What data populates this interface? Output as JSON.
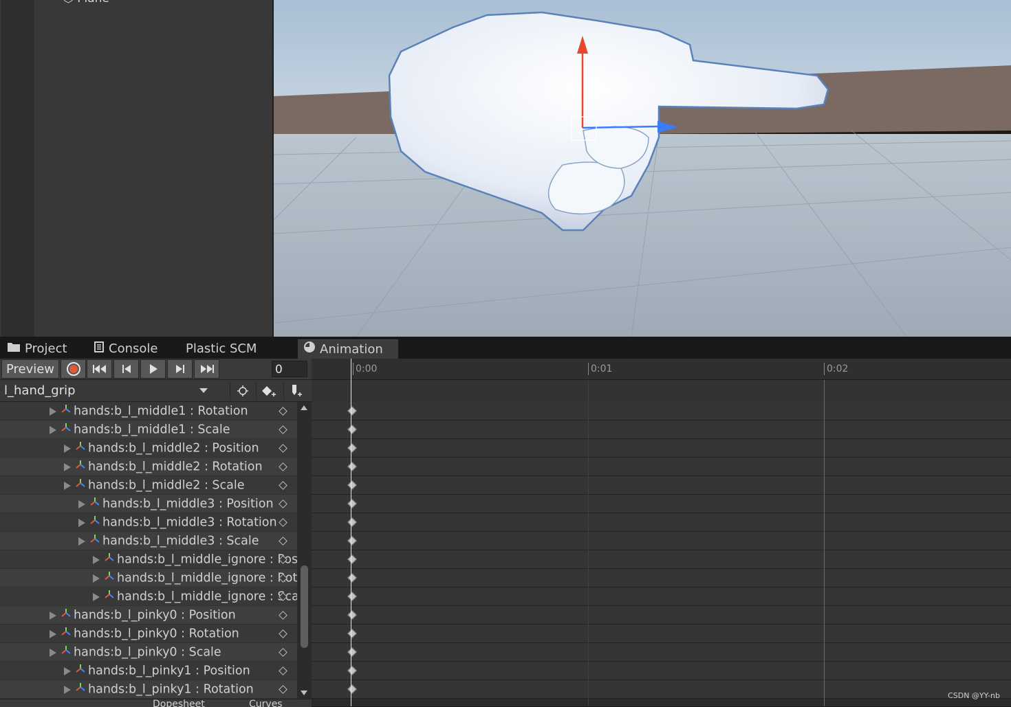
{
  "hierarchy": {
    "clipped_item": "Plane"
  },
  "tabs": [
    {
      "label": "Project",
      "icon": "folder-icon"
    },
    {
      "label": "Console",
      "icon": "console-icon"
    },
    {
      "label": "Plastic SCM",
      "icon": ""
    },
    {
      "label": "Animation",
      "icon": "clock-icon"
    }
  ],
  "toolbar": {
    "preview_label": "Preview",
    "frame_value": "0",
    "buttons": [
      "record-icon",
      "first-key-icon",
      "prev-key-icon",
      "play-icon",
      "next-key-icon",
      "last-key-icon"
    ]
  },
  "clip": {
    "name": "l_hand_grip",
    "tools": [
      "filter-by-selection-icon",
      "add-keyframe-icon",
      "add-event-icon"
    ]
  },
  "properties": [
    {
      "label": "hands:b_l_middle1 : Rotation",
      "indent": 0
    },
    {
      "label": "hands:b_l_middle1 : Scale",
      "indent": 0
    },
    {
      "label": "hands:b_l_middle2 : Position",
      "indent": 1
    },
    {
      "label": "hands:b_l_middle2 : Rotation",
      "indent": 1
    },
    {
      "label": "hands:b_l_middle2 : Scale",
      "indent": 1
    },
    {
      "label": "hands:b_l_middle3 : Position",
      "indent": 2
    },
    {
      "label": "hands:b_l_middle3 : Rotation",
      "indent": 2
    },
    {
      "label": "hands:b_l_middle3 : Scale",
      "indent": 2
    },
    {
      "label": "hands:b_l_middle_ignore : Pos",
      "indent": 3
    },
    {
      "label": "hands:b_l_middle_ignore : Rota",
      "indent": 3
    },
    {
      "label": "hands:b_l_middle_ignore : Sca",
      "indent": 3
    },
    {
      "label": "hands:b_l_pinky0 : Position",
      "indent": 0
    },
    {
      "label": "hands:b_l_pinky0 : Rotation",
      "indent": 0
    },
    {
      "label": "hands:b_l_pinky0 : Scale",
      "indent": 0
    },
    {
      "label": "hands:b_l_pinky1 : Position",
      "indent": 1
    },
    {
      "label": "hands:b_l_pinky1 : Rotation",
      "indent": 1
    }
  ],
  "bottom_buttons": [
    "Dopesheet",
    "Curves"
  ],
  "timeline": {
    "ticks": [
      "0:00",
      "0:01",
      "0:02"
    ],
    "current_frame": 0
  },
  "watermark": "CSDN @YY-nb",
  "colors": {
    "record": "#e05a3a",
    "axis_y": "#e8462d",
    "axis_z": "#3b7cff",
    "selection_outline": "#4a7ab8"
  }
}
